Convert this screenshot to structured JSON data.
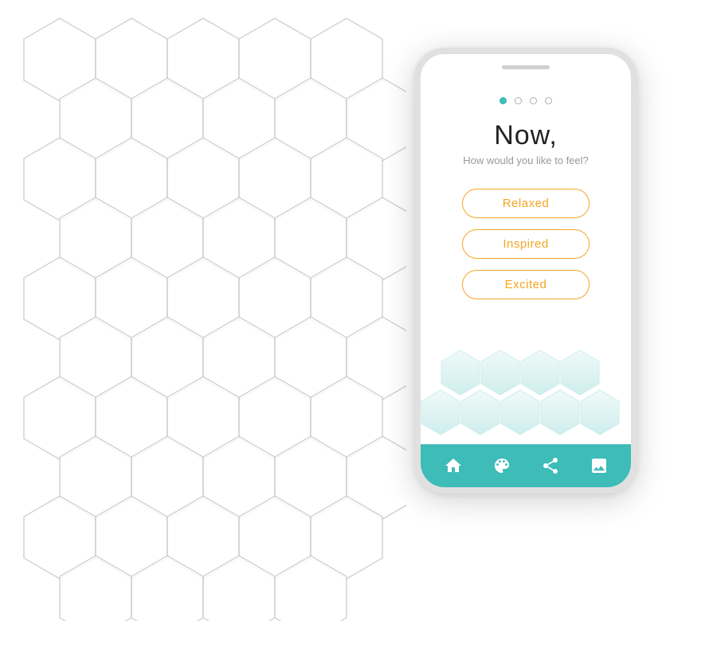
{
  "page": {
    "bg_color": "#ffffff"
  },
  "phone": {
    "title": "Now,",
    "subtitle": "How would you like to feel?",
    "dots": [
      {
        "active": true
      },
      {
        "active": false
      },
      {
        "active": false
      },
      {
        "active": false
      }
    ],
    "buttons": [
      {
        "label": "Relaxed"
      },
      {
        "label": "Inspired"
      },
      {
        "label": "Excited"
      }
    ],
    "tabs": [
      {
        "icon": "home-icon"
      },
      {
        "icon": "palette-icon"
      },
      {
        "icon": "share-icon"
      },
      {
        "icon": "image-icon"
      }
    ]
  }
}
